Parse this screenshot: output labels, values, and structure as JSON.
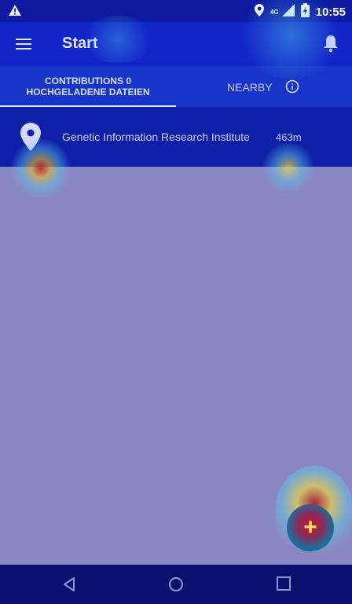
{
  "statusbar": {
    "network": "4G",
    "time": "10:55"
  },
  "appbar": {
    "title": "Start"
  },
  "tabs": {
    "contributions": "CONTRIBUTIONS 0",
    "uploaded": "HOCHGELADENE DATEIEN",
    "nearby": "NEARBY"
  },
  "list": [
    {
      "name": "Genetic Information Research Institute",
      "distance": "463m"
    }
  ],
  "fab": {
    "label": "+"
  },
  "icons": {
    "warning": "warning-icon",
    "location": "location-icon",
    "battery": "battery-icon",
    "menu": "menu-icon",
    "bell": "bell-icon",
    "info": "info-icon",
    "pin": "map-pin-icon",
    "back": "back-icon",
    "home": "home-icon",
    "recents": "recents-icon"
  },
  "colors": {
    "primary": "#1225c6",
    "status_bar": "#0d1aa0",
    "background": "#8a87c6",
    "nav_bar": "#0a0f6e"
  }
}
